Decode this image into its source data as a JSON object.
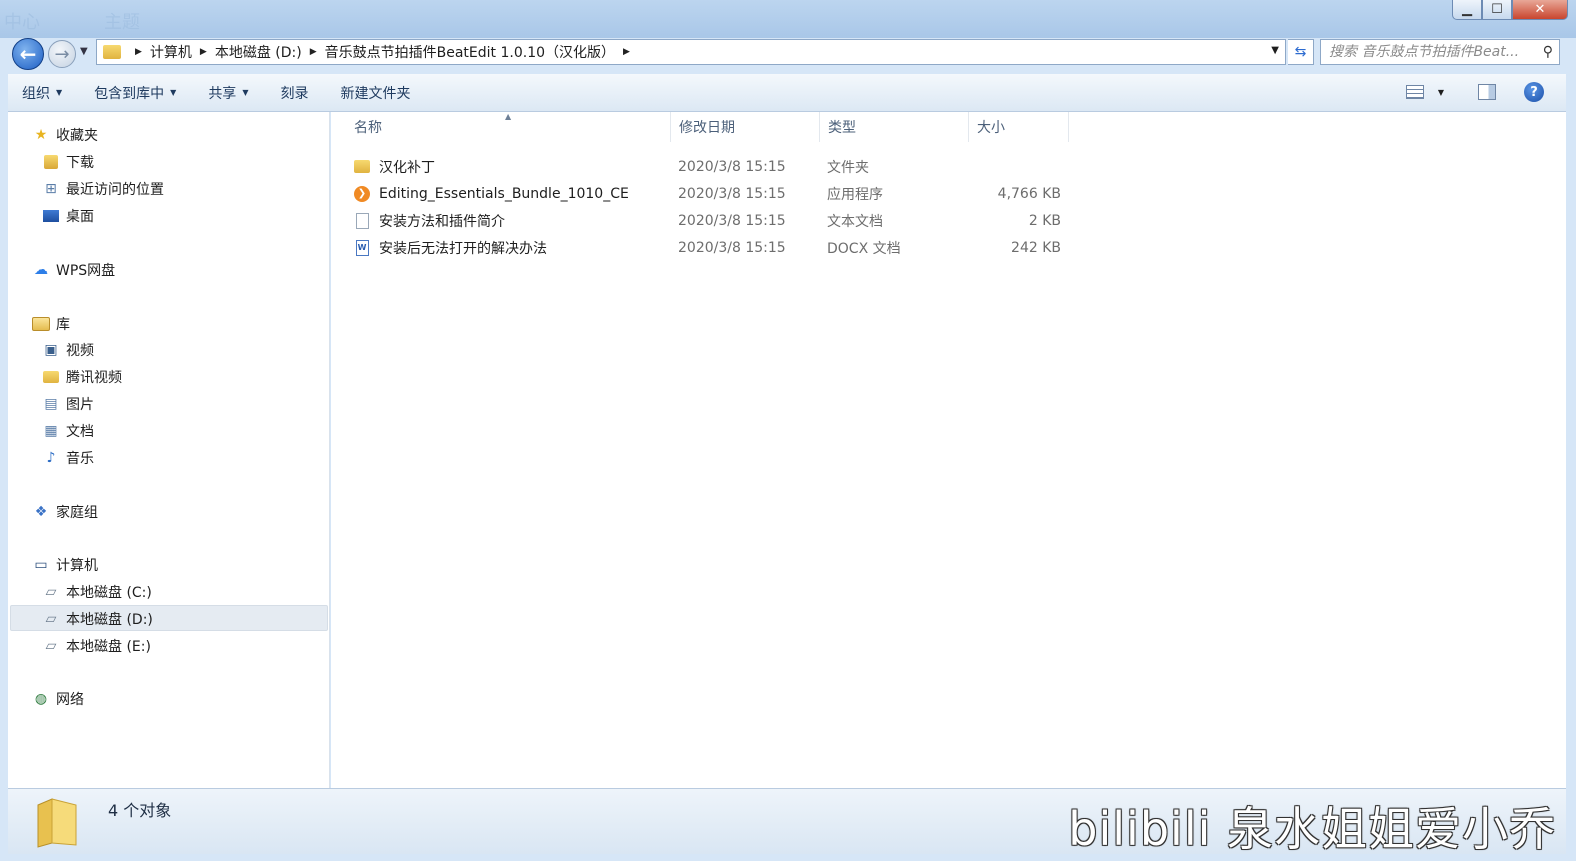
{
  "window": {
    "bg_texts": [
      "中心",
      "主题"
    ],
    "min_label": "▁",
    "max_label": "☐",
    "close_label": "✕"
  },
  "address": {
    "crumbs": [
      "计算机",
      "本地磁盘 (D:)",
      "音乐鼓点节拍插件BeatEdit 1.0.10（汉化版）"
    ],
    "search_placeholder": "搜索 音乐鼓点节拍插件Beat..."
  },
  "toolbar": {
    "organize": "组织",
    "include_library": "包含到库中",
    "share": "共享",
    "burn": "刻录",
    "new_folder": "新建文件夹"
  },
  "nav": {
    "favorites": "收藏夹",
    "downloads": "下载",
    "recent": "最近访问的位置",
    "desktop": "桌面",
    "wps": "WPS网盘",
    "libraries": "库",
    "videos": "视频",
    "tencent_video": "腾讯视频",
    "pictures": "图片",
    "documents": "文档",
    "music": "音乐",
    "homegroup": "家庭组",
    "computer": "计算机",
    "drive_c": "本地磁盘 (C:)",
    "drive_d": "本地磁盘 (D:)",
    "drive_e": "本地磁盘 (E:)",
    "network": "网络"
  },
  "columns": {
    "name": "名称",
    "date": "修改日期",
    "type": "类型",
    "size": "大小"
  },
  "files": [
    {
      "name": "汉化补丁",
      "date": "2020/3/8 15:15",
      "type": "文件夹",
      "size": "",
      "icon": "folder-icon"
    },
    {
      "name": "Editing_Essentials_Bundle_1010_CE",
      "date": "2020/3/8 15:15",
      "type": "应用程序",
      "size": "4,766 KB",
      "icon": "installer-icon"
    },
    {
      "name": "安装方法和插件简介",
      "date": "2020/3/8 15:15",
      "type": "文本文档",
      "size": "2 KB",
      "icon": "text-file-icon"
    },
    {
      "name": "安装后无法打开的解决办法",
      "date": "2020/3/8 15:15",
      "type": "DOCX 文档",
      "size": "242 KB",
      "icon": "docx-file-icon"
    }
  ],
  "status": {
    "count": "4 个对象"
  },
  "watermark": "bilibili 泉水姐姐爱小乔",
  "colors": {
    "accent": "#1d5ec4",
    "selection": "#e5ebf2",
    "close": "#c9452e"
  }
}
